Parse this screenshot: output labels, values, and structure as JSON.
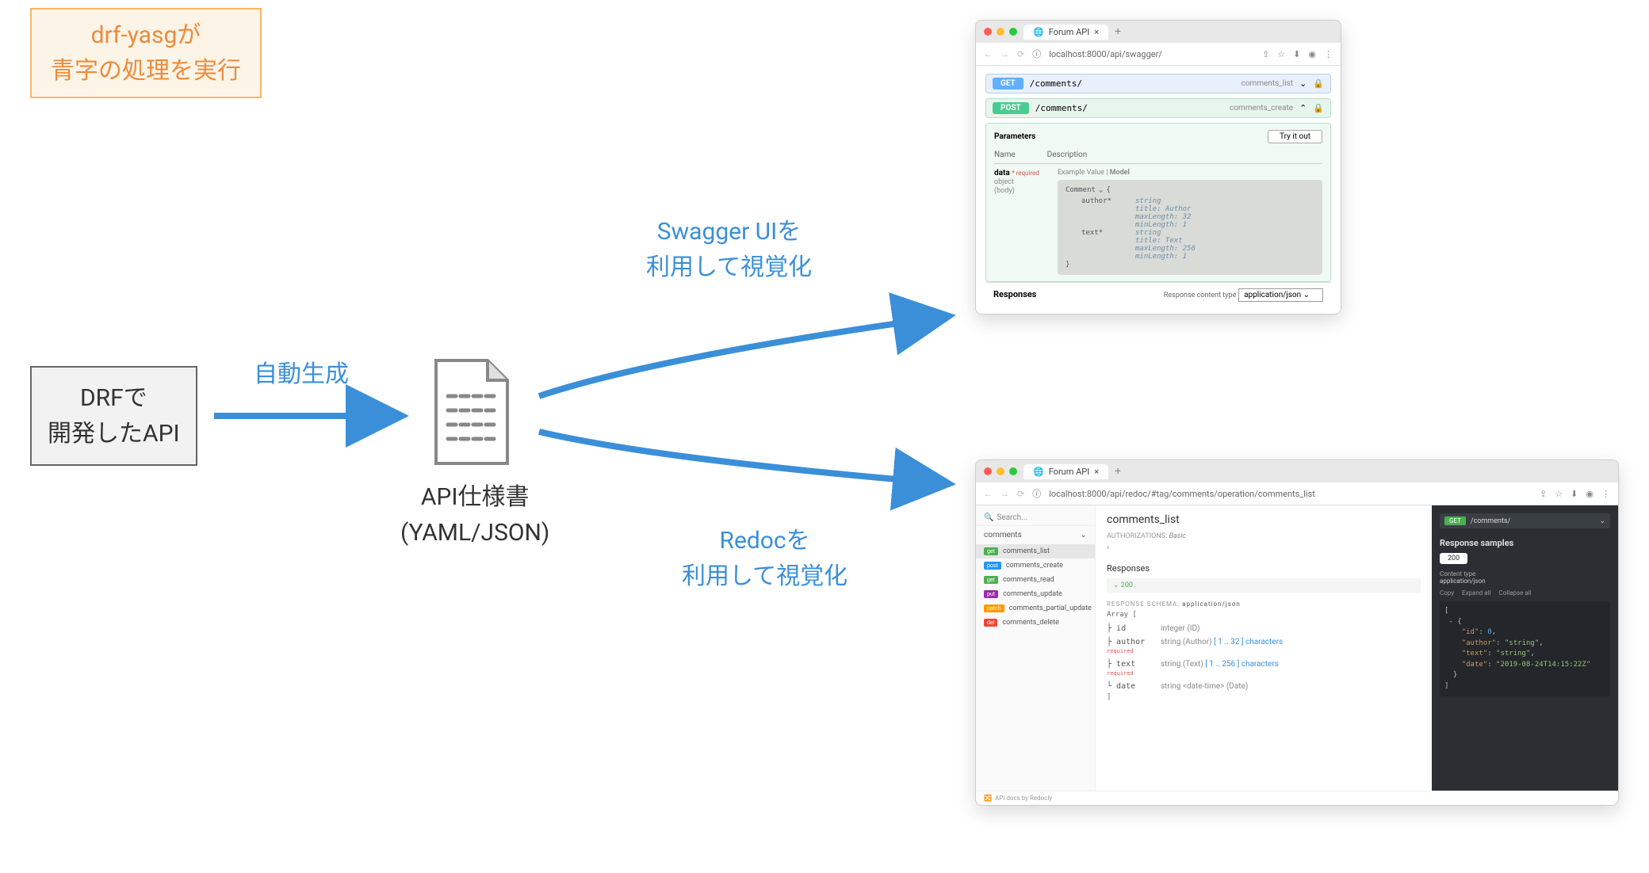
{
  "callout": {
    "line1": "drf-yasgが",
    "line2": "青字の処理を実行"
  },
  "source": {
    "line1": "DRFで",
    "line2": "開発したAPI"
  },
  "arrow_labels": {
    "autogen": "自動生成",
    "swagger_line1": "Swagger UIを",
    "swagger_line2": "利用して視覚化",
    "redoc_line1": "Redocを",
    "redoc_line2": "利用して視覚化"
  },
  "spec": {
    "line1": "API仕様書",
    "line2": "(YAML/JSON)"
  },
  "swagger": {
    "tab_title": "Forum API",
    "url": "localhost:8000/api/swagger/",
    "ops": [
      {
        "method": "GET",
        "path": "/comments/",
        "opid": "comments_list"
      },
      {
        "method": "POST",
        "path": "/comments/",
        "opid": "comments_create"
      }
    ],
    "parameters_label": "Parameters",
    "tryout_label": "Try it out",
    "col_name": "Name",
    "col_desc": "Description",
    "param_name": "data",
    "param_required": "* required",
    "param_type1": "object",
    "param_type2": "(body)",
    "example_label": "Example Value",
    "model_label": "Model",
    "model_name": "Comment",
    "fields": [
      {
        "name": "author*",
        "lines": [
          "string",
          "title: Author",
          "maxLength: 32",
          "minLength: 1"
        ]
      },
      {
        "name": "text*",
        "lines": [
          "string",
          "title: Text",
          "maxLength: 256",
          "minLength: 1"
        ]
      }
    ],
    "responses_label": "Responses",
    "content_type_label": "Response content type",
    "content_type_value": "application/json"
  },
  "redoc": {
    "tab_title": "Forum API",
    "url": "localhost:8000/api/redoc/#tag/comments/operation/comments_list",
    "search_placeholder": "Search...",
    "group": "comments",
    "items": [
      {
        "method": "get",
        "label": "comments_list",
        "active": true
      },
      {
        "method": "post",
        "label": "comments_create"
      },
      {
        "method": "get",
        "label": "comments_read"
      },
      {
        "method": "put",
        "label": "comments_update"
      },
      {
        "method": "patch",
        "label": "comments_partial_update"
      },
      {
        "method": "del",
        "label": "comments_delete"
      }
    ],
    "title": "comments_list",
    "auth_label": "AUTHORIZATIONS:",
    "auth_value": "Basic",
    "responses_label": "Responses",
    "ok_label": "200",
    "schema_label": "RESPONSE SCHEMA:",
    "schema_type": "application/json",
    "array_label": "Array [",
    "fields": [
      {
        "name": "id",
        "req": false,
        "desc": "integer (ID)"
      },
      {
        "name": "author",
        "req": true,
        "desc": "string (Author)",
        "range": "[ 1 .. 32 ] characters"
      },
      {
        "name": "text",
        "req": true,
        "desc": "string (Text)",
        "range": "[ 1 .. 256 ] characters"
      },
      {
        "name": "date",
        "req": false,
        "desc": "string <date-time> (Date)"
      }
    ],
    "right": {
      "method": "GET",
      "path": "/comments/",
      "samples_label": "Response samples",
      "chip": "200",
      "content_type_label": "Content type",
      "content_type_value": "application/json",
      "copy": "Copy",
      "expand": "Expand all",
      "collapse": "Collapse all",
      "json_id_key": "\"id\"",
      "json_id_val": "0",
      "json_author_key": "\"author\"",
      "json_author_val": "\"string\"",
      "json_text_key": "\"text\"",
      "json_text_val": "\"string\"",
      "json_date_key": "\"date\"",
      "json_date_val": "\"2019-08-24T14:15:22Z\""
    },
    "footer": "API docs by Redocly"
  }
}
